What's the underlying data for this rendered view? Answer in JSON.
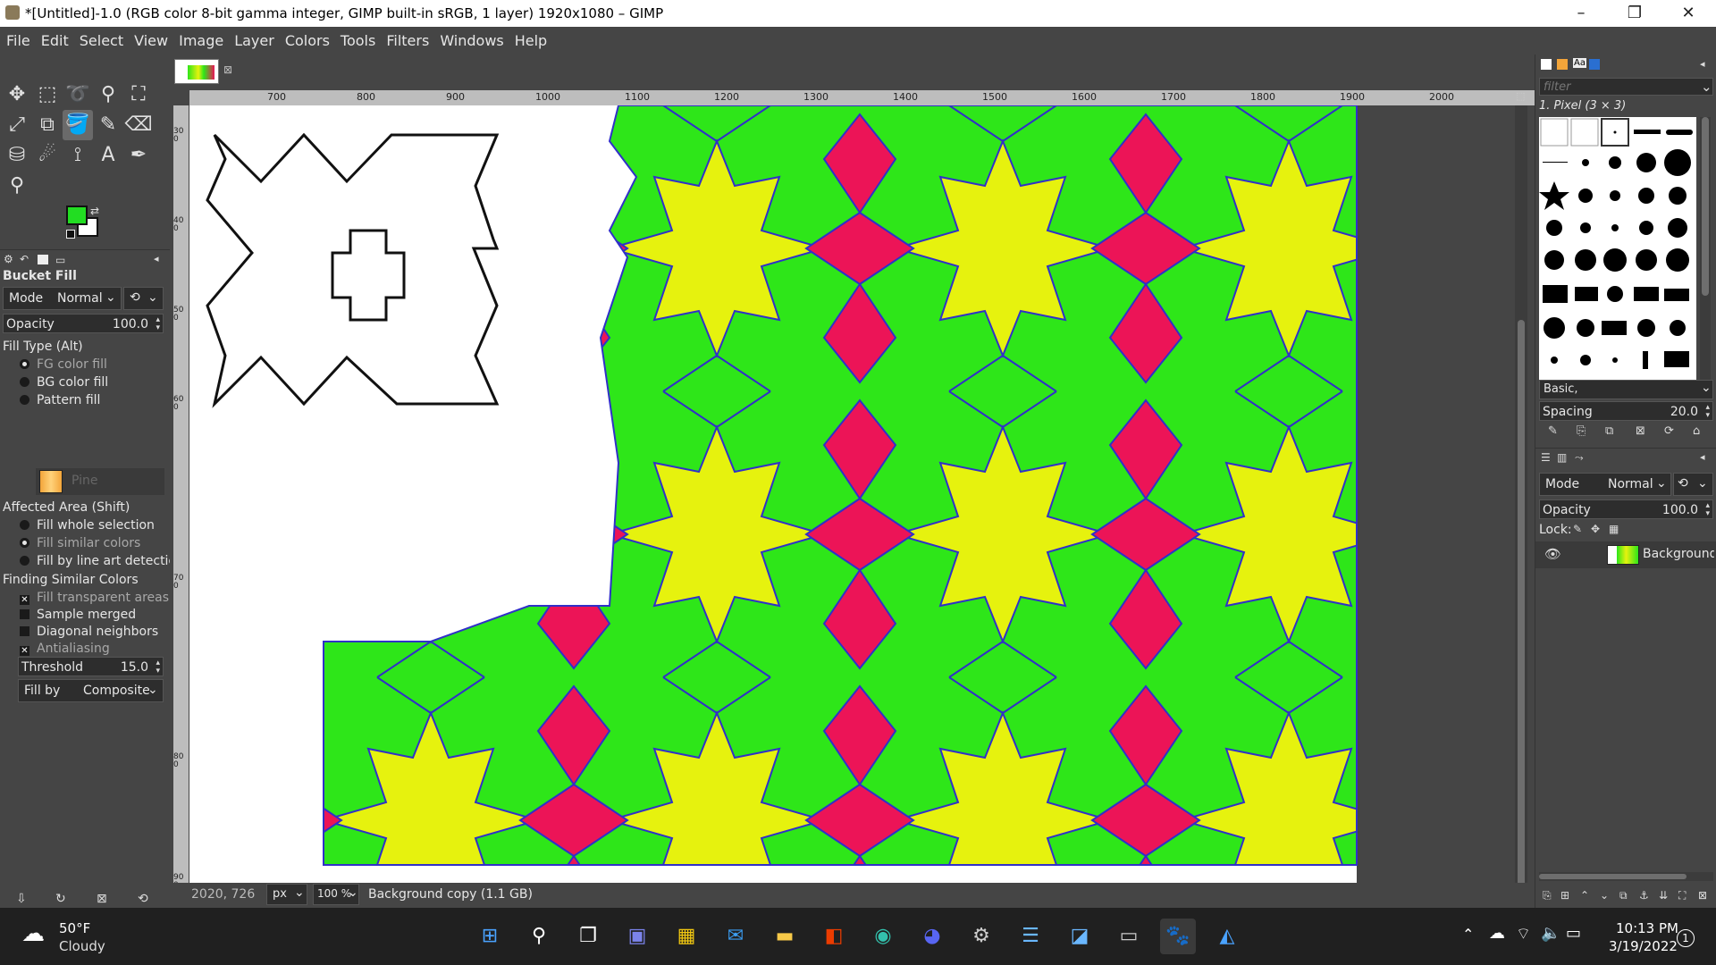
{
  "window": {
    "title": "*[Untitled]-1.0 (RGB color 8-bit gamma integer, GIMP built-in sRGB, 1 layer) 1920x1080 – GIMP",
    "minimize": "–",
    "restore": "❐",
    "close": "✕"
  },
  "menu": [
    "File",
    "Edit",
    "Select",
    "View",
    "Image",
    "Layer",
    "Colors",
    "Tools",
    "Filters",
    "Windows",
    "Help"
  ],
  "tool_options": {
    "title": "Bucket Fill",
    "mode_label": "Mode",
    "mode_value": "Normal",
    "opacity_label": "Opacity",
    "opacity_value": "100.0",
    "fill_type_label": "Fill Type  (Alt)",
    "fill_types": [
      "FG color fill",
      "BG color fill",
      "Pattern fill"
    ],
    "pattern_name": "Pine",
    "affected_area_label": "Affected Area  (Shift)",
    "affected_areas": [
      "Fill whole selection",
      "Fill similar colors",
      "Fill by line art detection"
    ],
    "finding_label": "Finding Similar Colors",
    "checks": [
      "Fill transparent areas",
      "Sample merged",
      "Diagonal neighbors",
      "Antialiasing"
    ],
    "threshold_label": "Threshold",
    "threshold_value": "15.0",
    "fill_by_label": "Fill by",
    "fill_by_value": "Composite"
  },
  "colors": {
    "fg": "#22dd22",
    "bg": "#ffffff",
    "green": "#2ee619",
    "yellow": "#e6f20e",
    "pink": "#ec1457",
    "outline": "#3030c8"
  },
  "ruler_labels": [
    "700",
    "800",
    "900",
    "1000",
    "1100",
    "1200",
    "1300",
    "1400",
    "1500",
    "1600",
    "1700",
    "1800",
    "1900",
    "2000"
  ],
  "vruler_labels": [
    "300",
    "400",
    "500",
    "600",
    "700",
    "800",
    "900"
  ],
  "status": {
    "coords": "2020, 726",
    "unit": "px",
    "zoom": "100 %",
    "message": "Background copy (1.1 GB)"
  },
  "brushes": {
    "filter_placeholder": "filter",
    "current": "1. Pixel (3 × 3)",
    "tag": "Basic,",
    "spacing_label": "Spacing",
    "spacing_value": "20.0"
  },
  "layers": {
    "mode_label": "Mode",
    "mode_value": "Normal",
    "opacity_label": "Opacity",
    "opacity_value": "100.0",
    "lock_label": "Lock:",
    "layer_name": "Background copy"
  },
  "taskbar": {
    "temp": "50°F",
    "weather": "Cloudy",
    "time": "10:13 PM",
    "date": "3/19/2022",
    "badge": "1"
  }
}
